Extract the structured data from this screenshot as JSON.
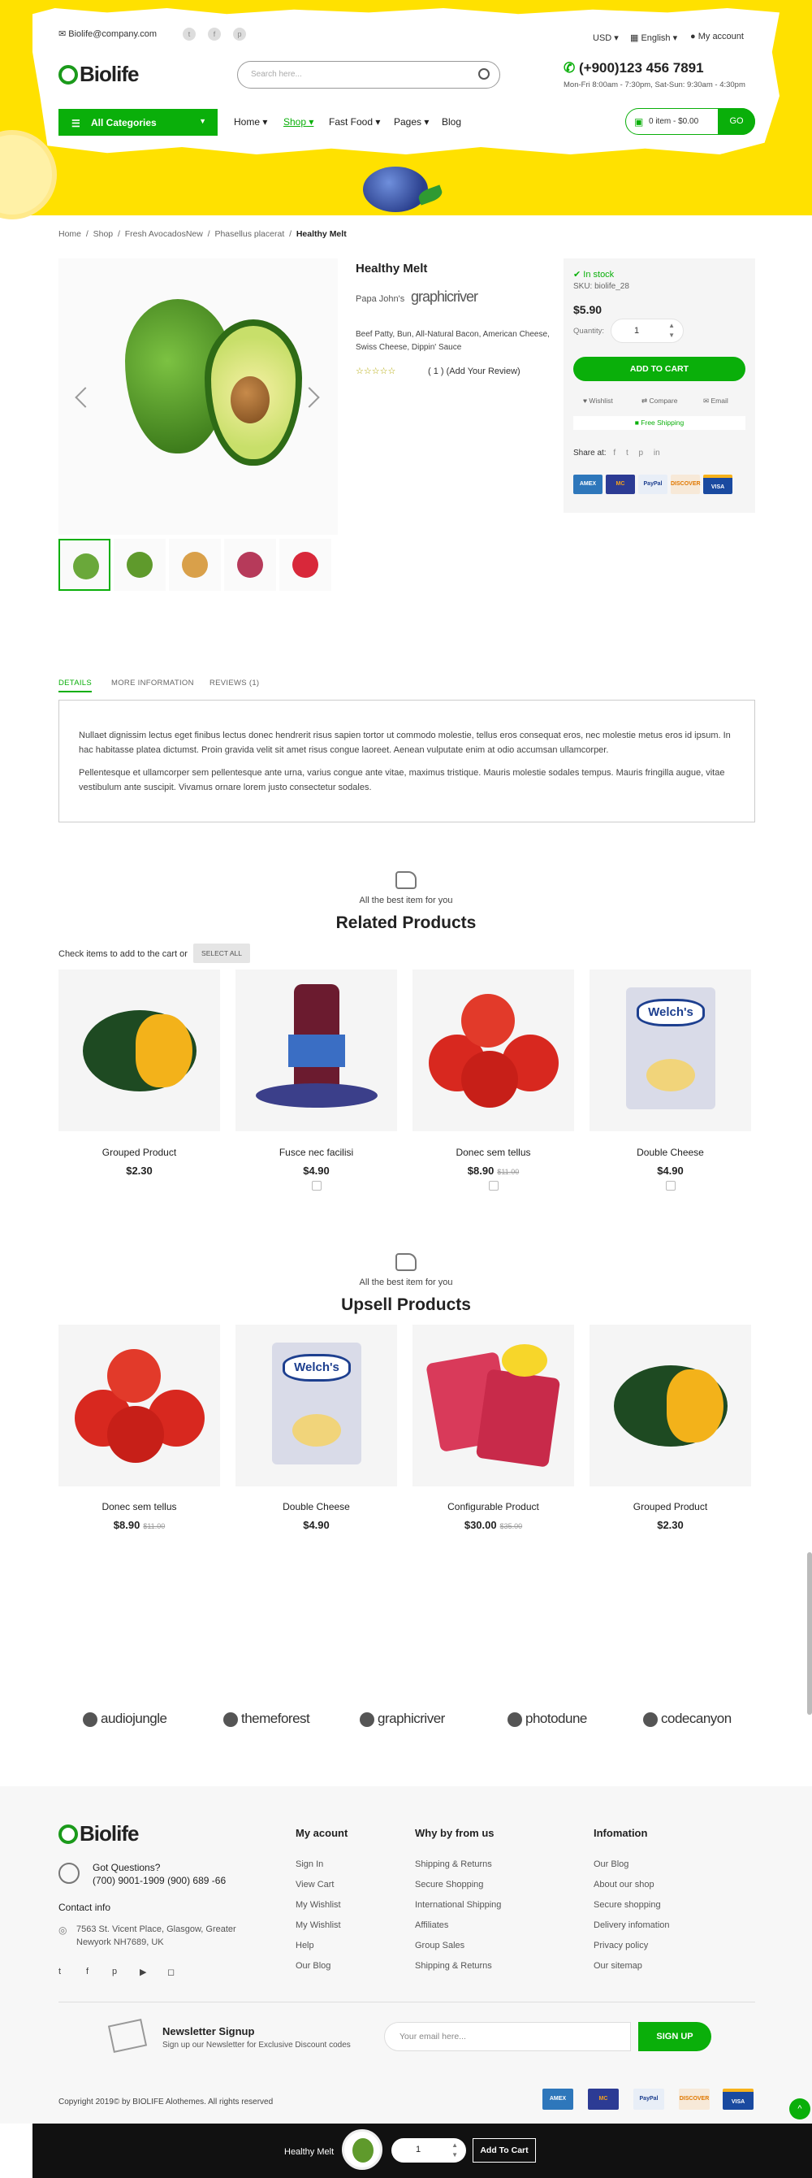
{
  "header": {
    "email": "Biolife@company.com",
    "currency": "USD",
    "language": "English",
    "account": "My account",
    "logo": "Biolife",
    "search_placeholder": "Search here...",
    "phone": "(+900)123 456 7891",
    "hours": "Mon-Fri 8:00am - 7:30pm, Sat-Sun: 9:30am - 4:30pm",
    "categories_label": "All Categories",
    "nav": [
      "Home",
      "Shop",
      "Fast Food",
      "Pages",
      "Blog"
    ],
    "cart_text": "0 item - $0.00",
    "cart_go": "GO"
  },
  "breadcrumb": [
    "Home",
    "Shop",
    "Fresh AvocadosNew",
    "Phasellus placerat",
    "Healthy Melt"
  ],
  "product": {
    "title": "Healthy Melt",
    "brand": "Papa John's",
    "brand_logo": "graphicriver",
    "description": "Beef Patty, Bun, All-Natural Bacon, American Cheese, Swiss Cheese, Dippin' Sauce",
    "rating_stars": "☆☆☆☆☆",
    "review_text": "( 1 )  (Add Your Review)",
    "stock": "In stock",
    "sku": "SKU: biolife_28",
    "price": "$5.90",
    "quantity_label": "Quantity:",
    "quantity": "1",
    "add_to_cart": "ADD TO CART",
    "wishlist": "Wishlist",
    "compare": "Compare",
    "email": "Email",
    "free_shipping": "Free Shipping",
    "share_label": "Share at:",
    "payments": [
      "AMEX",
      "MC",
      "PayPal",
      "DISCOVER",
      "VISA"
    ]
  },
  "tabs": [
    "DETAILS",
    "MORE INFORMATION",
    "REVIEWS (1)"
  ],
  "details": [
    "Nullaet dignissim lectus eget finibus lectus donec hendrerit risus sapien tortor ut commodo molestie, tellus eros consequat eros, nec molestie metus eros id ipsum. In hac habitasse platea dictumst. Proin gravida velit sit amet risus congue laoreet. Aenean vulputate enim at odio accumsan ullamcorper.",
    "Pellentesque et ullamcorper sem pellentesque ante urna, varius congue ante vitae, maximus tristique. Mauris molestie sodales tempus. Mauris fringilla augue, vitae vestibulum ante suscipit. Vivamus ornare lorem justo consectetur sodales."
  ],
  "related": {
    "hint": "All the best item for you",
    "title": "Related Products",
    "check_text": "Check items to add to the cart or",
    "select_all": "SELECT ALL",
    "items": [
      {
        "name": "Grouped Product",
        "price": "$2.30",
        "old": ""
      },
      {
        "name": "Fusce nec facilisi",
        "price": "$4.90",
        "old": ""
      },
      {
        "name": "Donec sem tellus",
        "price": "$8.90",
        "old": "$11.00"
      },
      {
        "name": "Double Cheese",
        "price": "$4.90",
        "old": ""
      }
    ]
  },
  "upsell": {
    "hint": "All the best item for you",
    "title": "Upsell Products",
    "items": [
      {
        "name": "Donec sem tellus",
        "price": "$8.90",
        "old": "$11.00"
      },
      {
        "name": "Double Cheese",
        "price": "$4.90",
        "old": ""
      },
      {
        "name": "Configurable Product",
        "price": "$30.00",
        "old": "$35.00"
      },
      {
        "name": "Grouped Product",
        "price": "$2.30",
        "old": ""
      }
    ]
  },
  "partners": [
    "audiojungle",
    "themeforest",
    "graphicriver",
    "photodune",
    "codecanyon"
  ],
  "footer": {
    "logo": "Biolife",
    "questions": "Got Questions?",
    "phones": "(700)  9001-1909 (900) 689 -66",
    "contact_title": "Contact info",
    "address": "7563 St. Vicent Place, Glasgow, Greater Newyork NH7689, UK",
    "col1_title": "My acount",
    "col1": [
      "Sign In",
      "View Cart",
      "My Wishlist",
      "My Wishlist",
      "Help",
      "Our Blog"
    ],
    "col2_title": "Why by from us",
    "col2": [
      "Shipping & Returns",
      "Secure Shopping",
      "International Shipping",
      "Affiliates",
      "Group Sales",
      "Shipping & Returns"
    ],
    "col3_title": "Infomation",
    "col3": [
      "Our Blog",
      "About our shop",
      "Secure shopping",
      "Delivery infomation",
      "Privacy policy",
      "Our sitemap"
    ],
    "newsletter_title": "Newsletter Signup",
    "newsletter_sub": "Sign up our Newsletter for Exclusive Discount codes",
    "email_placeholder": "Your email here...",
    "signup": "SIGN UP",
    "copyright": "Copyright 2019© by BIOLIFE Alothemes. All rights reserved"
  },
  "sticky": {
    "name": "Healthy Melt",
    "quantity": "1",
    "button": "Add To Cart"
  },
  "colors": {
    "accent": "#0aaf0a",
    "header_bg": "#ffe100"
  }
}
